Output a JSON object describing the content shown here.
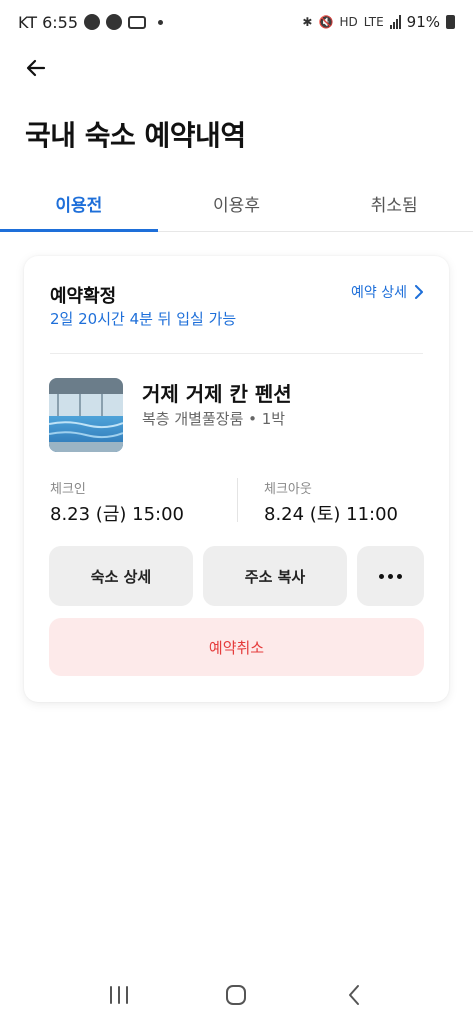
{
  "status_bar": {
    "carrier_time": "KT 6:55",
    "network": "LTE",
    "battery_percent": "91%"
  },
  "header": {
    "title": "국내 숙소 예약내역"
  },
  "tabs": [
    {
      "label": "이용전",
      "active": true
    },
    {
      "label": "이용후",
      "active": false
    },
    {
      "label": "취소됨",
      "active": false
    }
  ],
  "reservation": {
    "status": "예약확정",
    "detail_link": "예약 상세",
    "countdown": "2일 20시간 4분 뒤 입실 가능",
    "property_name": "거제 거제 칸 펜션",
    "room_info": "복층 개별풀장룸 • 1박",
    "checkin": {
      "label": "체크인",
      "value": "8.23 (금) 15:00"
    },
    "checkout": {
      "label": "체크아웃",
      "value": "8.24 (토) 11:00"
    },
    "buttons": {
      "property_detail": "숙소 상세",
      "copy_address": "주소 복사",
      "cancel": "예약취소"
    }
  },
  "colors": {
    "accent": "#1e6fd9",
    "cancel_bg": "#fdeaea",
    "cancel_text": "#e53c3c",
    "button_bg": "#eeeeee"
  }
}
